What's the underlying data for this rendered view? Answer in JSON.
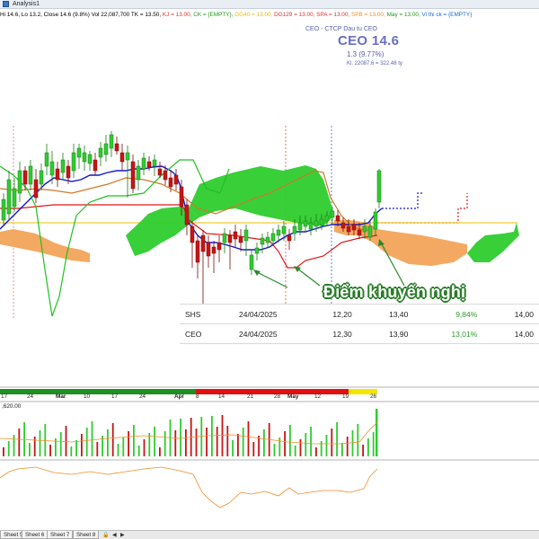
{
  "window": {
    "title": "Analysis1"
  },
  "info_bar": {
    "items": [
      {
        "text": "Hi 14.6, Lo 13.2, Close 14.6 (9.8%) Vol 22,087,700 TK = 13.50, ",
        "color": "#000000"
      },
      {
        "text": "KJ = 13.00, ",
        "color": "#e03030"
      },
      {
        "text": "CK = {EMPTY}, ",
        "color": "#1a9a1a"
      },
      {
        "text": "GG40 = 13.00, ",
        "color": "#e0c000"
      },
      {
        "text": "DG129 = 13.00, ",
        "color": "#e03030"
      },
      {
        "text": "SPA = 13.00, ",
        "color": "#e03030"
      },
      {
        "text": "SPB = 13.00, ",
        "color": "#f08c2a"
      },
      {
        "text": "May = 13.00, ",
        "color": "#1a9a1a"
      },
      {
        "text": "Vi thi ck = {EMPTY}",
        "color": "#1a6ad0"
      }
    ]
  },
  "header": {
    "company": "CEO - CTCP Dau tu CEO",
    "ticker_price": "CEO 14.6",
    "change": "1.3 (9.77%)",
    "volume": "Kl. 22087.6 = 322.48 ty"
  },
  "annotation": {
    "label": "Điểm khuyến nghị"
  },
  "recommendations": {
    "rows": [
      {
        "symbol": "SHS",
        "date": "24/04/2025",
        "buy": "12,20",
        "price": "13,40",
        "change": "9,84%",
        "target": "14,00"
      },
      {
        "symbol": "CEO",
        "date": "24/04/2025",
        "buy": "12,30",
        "price": "13,90",
        "change": "13,01%",
        "target": "14,00"
      }
    ]
  },
  "timeline": {
    "labels": [
      "17",
      "24",
      "Mar",
      "10",
      "17",
      "24",
      "Apr",
      "8",
      "14",
      "21",
      "28",
      "May",
      "12",
      "19",
      "26"
    ],
    "segment_colors": {
      "green": "#1f8f1f",
      "red": "#e01010",
      "yellow": "#f2e600"
    }
  },
  "volume_panel": {
    "label": ",620.00"
  },
  "sheet_tabs": {
    "tabs": [
      "Sheet 5",
      "Sheet 6",
      "Sheet 7",
      "Sheet 8"
    ]
  },
  "chart_data": {
    "type": "candlestick",
    "title": "CEO 14.6",
    "up_color": "#2ecc2e",
    "down_color": "#c81414",
    "last_close": 14.6,
    "volume_last": 22087700
  }
}
